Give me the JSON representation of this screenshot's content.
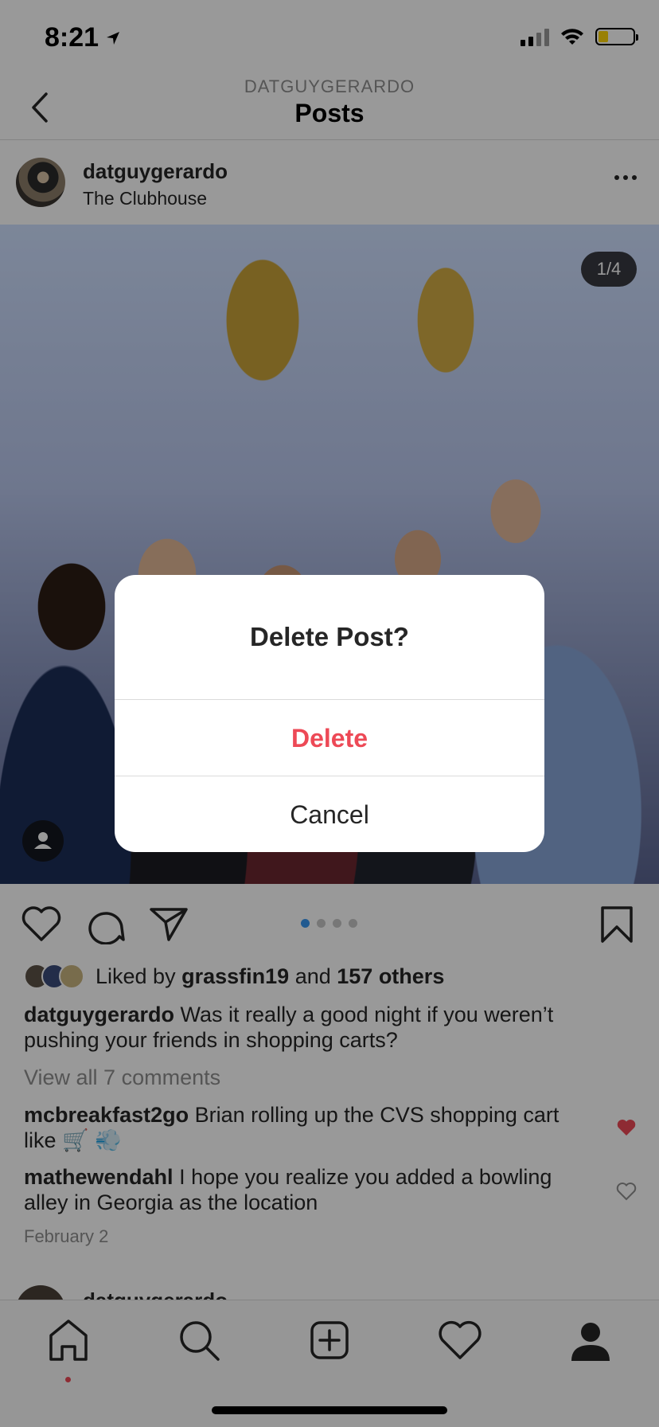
{
  "status_bar": {
    "time": "8:21"
  },
  "header": {
    "subtitle": "DATGUYGERARDO",
    "title": "Posts"
  },
  "post": {
    "username": "datguygerardo",
    "location": "The Clubhouse",
    "photo_counter": "1/4",
    "carousel": {
      "total": 4,
      "active_index": 0
    },
    "liked_by": {
      "prefix": "Liked by",
      "user": "grassfin19",
      "joiner": "and",
      "others": "157 others"
    },
    "caption": {
      "username": "datguygerardo",
      "text": "Was it really a good night if you weren’t pushing your friends in shopping carts?"
    },
    "view_all_comments": "View all 7 comments",
    "comments": [
      {
        "username": "mcbreakfast2go",
        "text": "Brian rolling up the CVS shopping cart like 🛒 💨",
        "liked": true
      },
      {
        "username": "mathewendahl",
        "text": "I hope you realize you added a bowling alley in Georgia as the location",
        "liked": false
      }
    ],
    "date": "February 2"
  },
  "next_post": {
    "username": "datguygerardo"
  },
  "dialog": {
    "title": "Delete Post?",
    "delete_label": "Delete",
    "cancel_label": "Cancel"
  },
  "colors": {
    "accent": "#3897f0",
    "destructive": "#ed4956",
    "text": "#262626",
    "muted": "#8e8e8e"
  }
}
